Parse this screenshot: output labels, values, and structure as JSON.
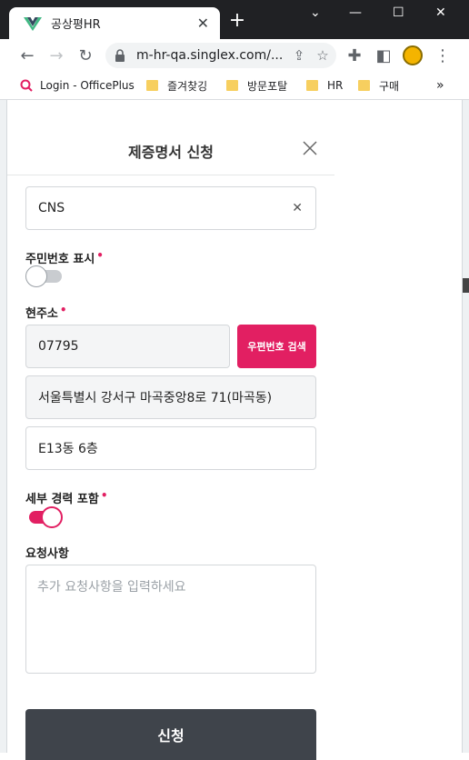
{
  "browser": {
    "tab_title": "공상평HR",
    "url": "m-hr-qa.singlex.com/...",
    "bookmarks": [
      {
        "label": "Login - OfficePlus",
        "kind": "site"
      },
      {
        "label": "즐겨찾깅",
        "kind": "folder"
      },
      {
        "label": "방문포탈",
        "kind": "folder"
      },
      {
        "label": "HR",
        "kind": "folder"
      },
      {
        "label": "구매",
        "kind": "folder"
      }
    ],
    "more_bookmarks": "»"
  },
  "popup": {
    "title": "제증명서 신청",
    "company_value": "CNS",
    "rrn_display": {
      "label": "주민번호 표시",
      "on": false
    },
    "address": {
      "label": "현주소",
      "zip": "07795",
      "zip_button": "우편번호 검색",
      "line1": "서울특별시 강서구 마곡중앙8로 71(마곡동)",
      "line2": "E13동 6층"
    },
    "detail_career": {
      "label": "세부 경력 포함",
      "on": true
    },
    "request": {
      "label": "요청사항",
      "placeholder": "추가 요청사항을 입력하세요"
    },
    "submit_label": "신청",
    "required_mark": "•"
  },
  "colors": {
    "accent": "#e21f62",
    "submit": "#3f444b",
    "toggle_off": "#c9ccd0"
  }
}
